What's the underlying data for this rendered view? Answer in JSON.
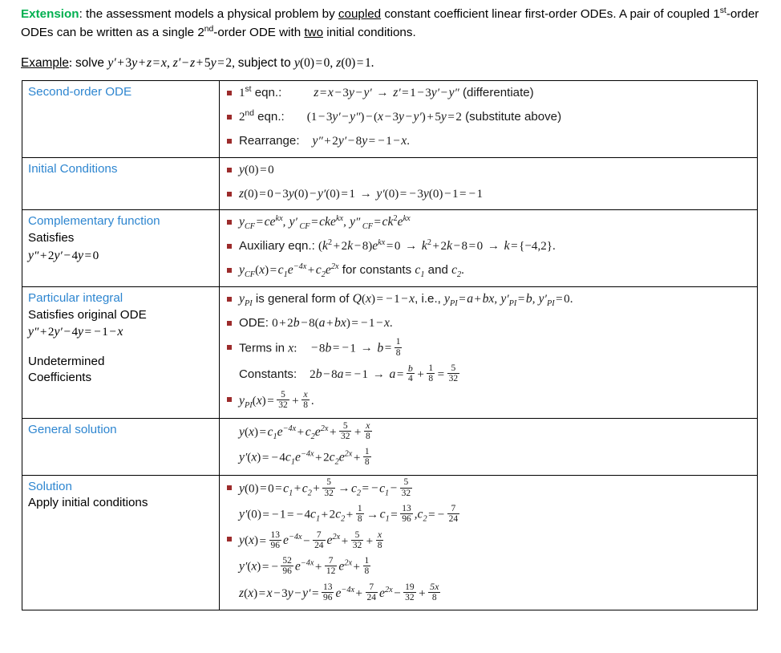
{
  "intro": {
    "keyword": "Extension",
    "line1_a": ": the assessment models a physical problem by ",
    "underlined1": "coupled",
    "line1_b": " constant coefficient linear first-order ODEs. A pair of coupled 1",
    "ord1": "st",
    "line1_c": "-order ODEs can be written as a single 2",
    "ord2": "nd",
    "line1_d": "-order ODE with ",
    "underlined2": "two",
    "line1_e": " initial conditions."
  },
  "example": {
    "label": "Example",
    "text": ": solve y′ + 3y + z = x, z′ − z + 5y = 2, subject to y(0) = 0, z(0) = 1."
  },
  "colors": {
    "green": "#00b050",
    "blue_label": "#2e86d0",
    "blue_equation": "#2372bd",
    "bullet_red": "#9c2b2b",
    "text": "#000000",
    "border": "#000000"
  },
  "table": {
    "rows": [
      {
        "label": "Second-order ODE",
        "label_extra": [],
        "items": [
          {
            "bullet": true,
            "tag": "1st eqn.:",
            "tag_sup": "st",
            "tag_base": "1",
            "tag_tail": " eqn.:",
            "equation": "z = x − 3y − y′ → z′ = 1 − 3y′ − y″ (differentiate)"
          },
          {
            "bullet": true,
            "tag_base": "2",
            "tag_sup": "nd",
            "tag_tail": " eqn.:",
            "equation": "(1 − 3y′ − y″) − (x − 3y − y′) + 5y = 2 (substitute above)"
          },
          {
            "bullet": true,
            "tag_base": "Rearrange:",
            "tag_sup": "",
            "tag_tail": "",
            "equation": "y″ + 2y′ − 8y = −1 − x."
          }
        ]
      },
      {
        "label": "Initial Conditions",
        "label_extra": [],
        "items": [
          {
            "bullet": true,
            "equation": "y(0) = 0"
          },
          {
            "bullet": true,
            "equation": "z(0) = 0 − 3y(0) − y′(0) = 1 → y′(0) = −3y(0) − 1 = −1"
          }
        ]
      },
      {
        "label": "Complementary function",
        "label_extra": [
          "Satisfies",
          "y″ + 2y′ − 4y = 0"
        ],
        "items": [
          {
            "bullet": true,
            "equation": "y_CF = ce^kx, y′_CF = cke^kx, y″_CF = ck²e^kx"
          },
          {
            "bullet": true,
            "blue": true,
            "equation": "Auxiliary eqn.: (k² + 2k − 8)e^kx = 0 → k² + 2k − 8 = 0 → k = {−4,2}."
          },
          {
            "bullet": true,
            "equation": "y_CF(x) = c₁e^−4x + c₂e^2x for constants c₁ and c₂."
          }
        ]
      },
      {
        "label": "Particular integral",
        "label_extra": [
          "Satisfies original ODE",
          "y″ + 2y′ − 4y = −1 − x",
          "",
          "Undetermined",
          "Coefficients"
        ],
        "items": [
          {
            "bullet": true,
            "equation": "y_PI is general form of Q(x) = −1 − x, i.e., y_PI = a + bx, y′_PI = b, y′_PI = 0."
          },
          {
            "bullet": true,
            "equation": "ODE: 0 + 2b − 8(a + bx) = −1 − x."
          },
          {
            "bullet": true,
            "equation": "Terms in x:  −8b = −1 → b = 1/8"
          },
          {
            "bullet": false,
            "equation": "Constants:  2b − 8a = −1 → a = b/4 + 1/8 = 5/32"
          },
          {
            "bullet": true,
            "equation": "y_PI(x) = 5/32 + x/8."
          }
        ]
      },
      {
        "label": "General solution",
        "label_extra": [],
        "items": [
          {
            "bullet": false,
            "equation": "y(x) = c₁e^−4x + c₂e^2x + 5/32 + x/8"
          },
          {
            "bullet": false,
            "equation": "y′(x) = −4c₁e^−4x + 2c₂e^2x + 1/8"
          }
        ]
      },
      {
        "label": "Solution",
        "label_extra": [
          "Apply initial conditions"
        ],
        "items": [
          {
            "bullet": true,
            "equation": "y(0) = 0 = c₁ + c₂ + 5/32 → c₂ = −c₁ − 5/32"
          },
          {
            "bullet": false,
            "equation": "y′(0) = −1 = −4c₁ + 2c₂ + 1/8 → c₁ = 13/96, c₂ = −7/24"
          },
          {
            "bullet": true,
            "blue": true,
            "equation": "y(x) = 13/96 e^−4x − 7/24 e^2x + 5/32 + x/8"
          },
          {
            "bullet": false,
            "blue": true,
            "equation": "y′(x) = −52/96 e^−4x + 7/12 e^2x + 1/8"
          },
          {
            "bullet": false,
            "blue": true,
            "equation": "z(x) = x − 3y − y′ = 13/96 e^−4x + 7/24 e^2x − 19/32 + 5x/8"
          }
        ]
      }
    ]
  }
}
